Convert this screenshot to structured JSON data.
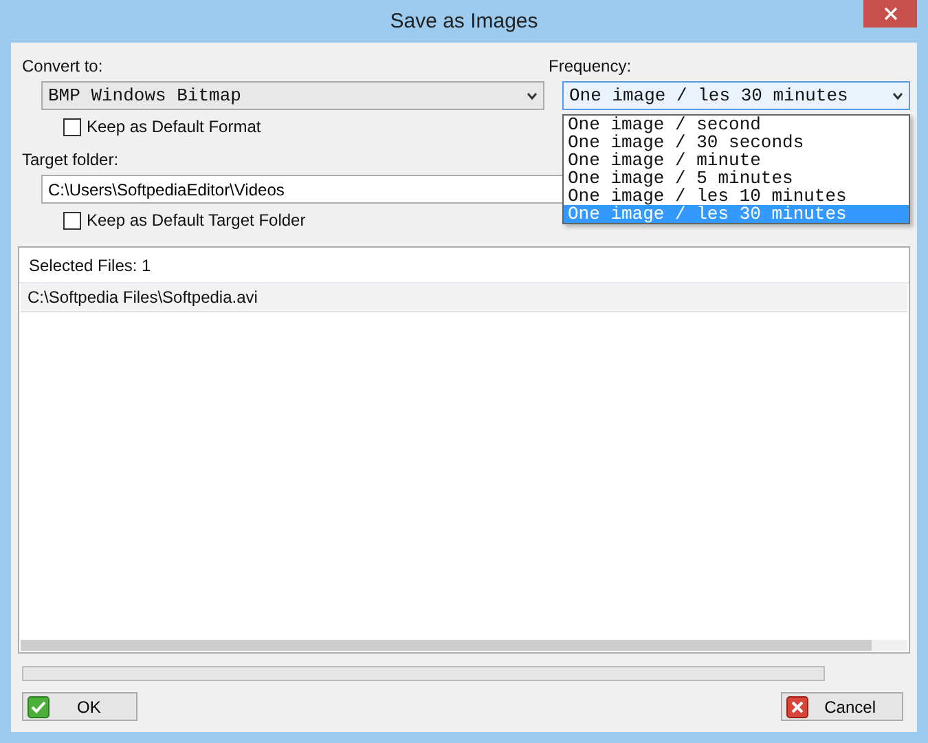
{
  "window": {
    "title": "Save as Images"
  },
  "convert_to": {
    "label": "Convert to:",
    "value": "BMP   Windows Bitmap",
    "keep_default": {
      "label": "Keep as Default Format",
      "checked": false
    }
  },
  "frequency": {
    "label": "Frequency:",
    "value": "One image / les 30 minutes",
    "expanded": true,
    "options": [
      {
        "label": "One image / second",
        "selected": false
      },
      {
        "label": "One image / 30 seconds",
        "selected": false
      },
      {
        "label": "One image / minute",
        "selected": false
      },
      {
        "label": "One image / 5 minutes",
        "selected": false
      },
      {
        "label": "One image / les 10 minutes",
        "selected": false
      },
      {
        "label": "One image / les 30 minutes",
        "selected": true
      }
    ]
  },
  "target_folder": {
    "label": "Target folder:",
    "value": "C:\\Users\\SoftpediaEditor\\Videos",
    "keep_default": {
      "label": "Keep as Default Target Folder",
      "checked": false
    }
  },
  "files": {
    "header": "Selected Files: 1",
    "rows": [
      "C:\\Softpedia Files\\Softpedia.avi"
    ]
  },
  "progress": {
    "level": 0
  },
  "buttons": [
    {
      "label": "OK",
      "kind": "ok"
    },
    {
      "label": "Cancel",
      "kind": "cancel"
    }
  ]
}
